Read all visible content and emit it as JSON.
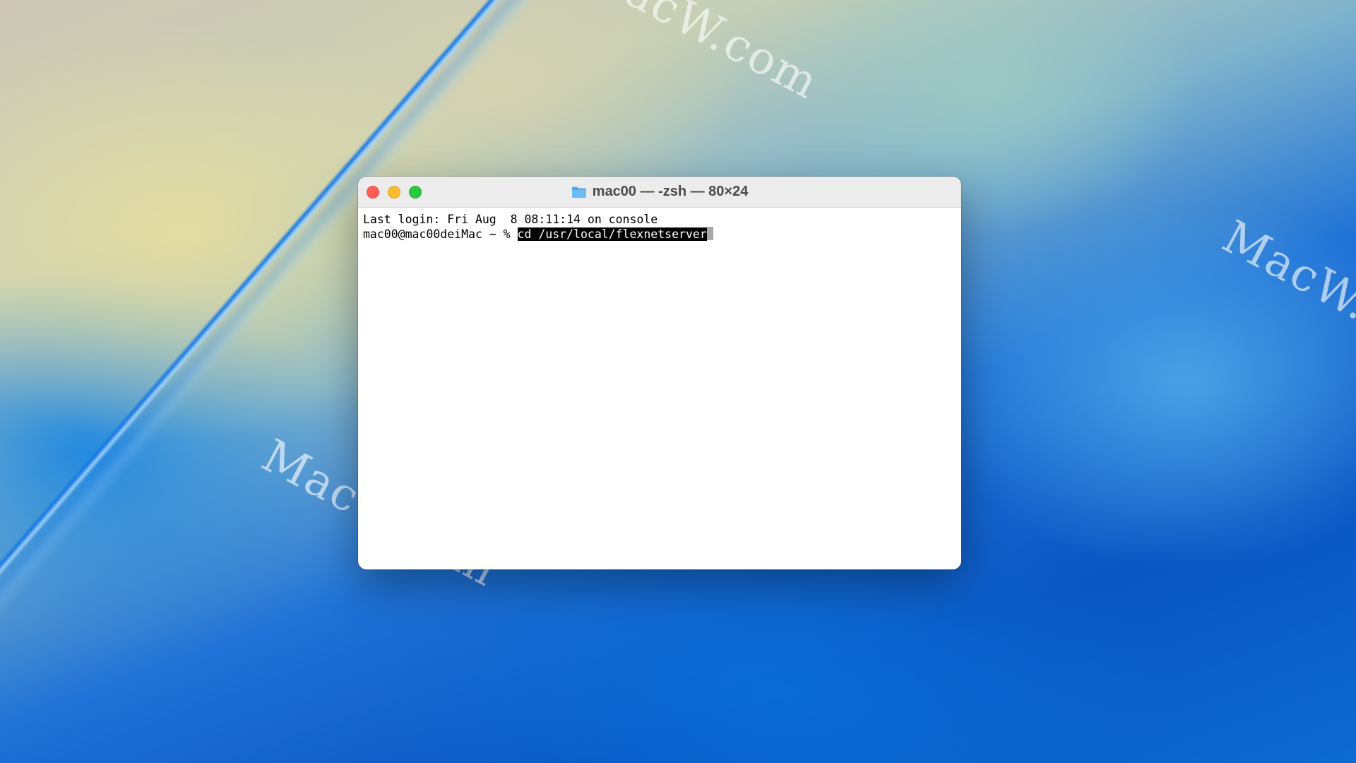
{
  "watermarks": [
    "MacW.com",
    "MacW.com",
    "MacW.com"
  ],
  "window": {
    "title": "mac00 — -zsh — 80×24",
    "title_icon": "folder-icon",
    "traffic_lights": {
      "close_color": "#ff5f57",
      "minimize_color": "#febc2e",
      "zoom_color": "#28c840"
    }
  },
  "terminal": {
    "lines": [
      {
        "text": "Last login: Fri Aug  8 08:11:14 on console"
      }
    ],
    "prompt": "mac00@mac00deiMac ~ % ",
    "command": "cd /usr/local/flexnetserver",
    "command_selected": true
  }
}
